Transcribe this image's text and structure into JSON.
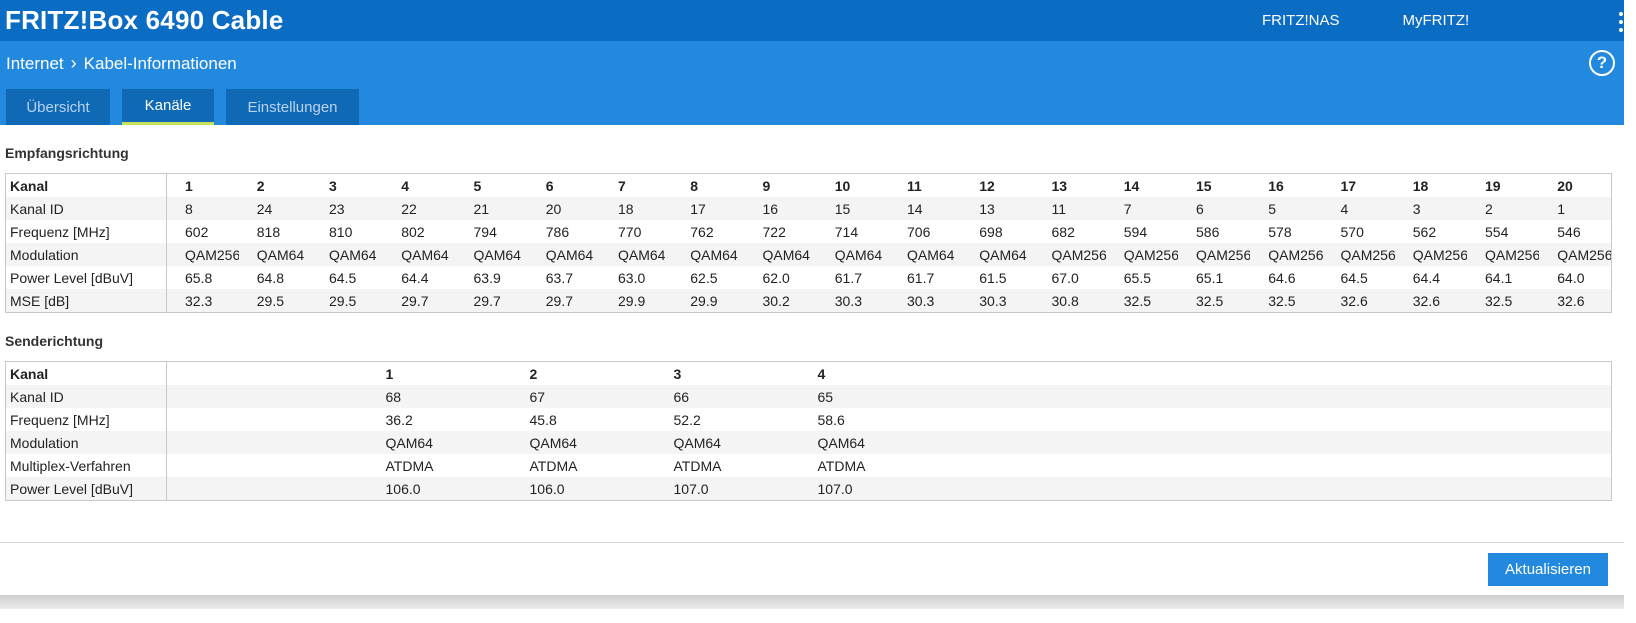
{
  "header": {
    "title": "FRITZ!Box 6490 Cable",
    "links": [
      "FRITZ!NAS",
      "MyFRITZ!"
    ]
  },
  "breadcrumb": [
    "Internet",
    "Kabel-Informationen"
  ],
  "tabs": [
    {
      "label": "Übersicht",
      "active": false
    },
    {
      "label": "Kanäle",
      "active": true
    },
    {
      "label": "Einstellungen",
      "active": false
    }
  ],
  "downstream": {
    "title": "Empfangsrichtung",
    "rows": [
      {
        "label": "Kanal",
        "values": [
          "1",
          "2",
          "3",
          "4",
          "5",
          "6",
          "7",
          "8",
          "9",
          "10",
          "11",
          "12",
          "13",
          "14",
          "15",
          "16",
          "17",
          "18",
          "19",
          "20"
        ]
      },
      {
        "label": "Kanal ID",
        "values": [
          "8",
          "24",
          "23",
          "22",
          "21",
          "20",
          "18",
          "17",
          "16",
          "15",
          "14",
          "13",
          "11",
          "7",
          "6",
          "5",
          "4",
          "3",
          "2",
          "1"
        ]
      },
      {
        "label": "Frequenz [MHz]",
        "values": [
          "602",
          "818",
          "810",
          "802",
          "794",
          "786",
          "770",
          "762",
          "722",
          "714",
          "706",
          "698",
          "682",
          "594",
          "586",
          "578",
          "570",
          "562",
          "554",
          "546"
        ]
      },
      {
        "label": "Modulation",
        "values": [
          "QAM256",
          "QAM64",
          "QAM64",
          "QAM64",
          "QAM64",
          "QAM64",
          "QAM64",
          "QAM64",
          "QAM64",
          "QAM64",
          "QAM64",
          "QAM64",
          "QAM256",
          "QAM256",
          "QAM256",
          "QAM256",
          "QAM256",
          "QAM256",
          "QAM256",
          "QAM256"
        ]
      },
      {
        "label": "Power Level [dBuV]",
        "values": [
          "65.8",
          "64.8",
          "64.5",
          "64.4",
          "63.9",
          "63.7",
          "63.0",
          "62.5",
          "62.0",
          "61.7",
          "61.7",
          "61.5",
          "67.0",
          "65.5",
          "65.1",
          "64.6",
          "64.5",
          "64.4",
          "64.1",
          "64.0"
        ]
      },
      {
        "label": "MSE [dB]",
        "values": [
          "32.3",
          "29.5",
          "29.5",
          "29.7",
          "29.7",
          "29.7",
          "29.9",
          "29.9",
          "30.2",
          "30.3",
          "30.3",
          "30.3",
          "30.8",
          "32.5",
          "32.5",
          "32.5",
          "32.6",
          "32.6",
          "32.5",
          "32.6"
        ]
      }
    ]
  },
  "upstream": {
    "title": "Senderichtung",
    "rows": [
      {
        "label": "Kanal",
        "values": [
          "1",
          "2",
          "3",
          "4"
        ]
      },
      {
        "label": "Kanal ID",
        "values": [
          "68",
          "67",
          "66",
          "65"
        ]
      },
      {
        "label": "Frequenz [MHz]",
        "values": [
          "36.2",
          "45.8",
          "52.2",
          "58.6"
        ]
      },
      {
        "label": "Modulation",
        "values": [
          "QAM64",
          "QAM64",
          "QAM64",
          "QAM64"
        ]
      },
      {
        "label": "Multiplex-Verfahren",
        "values": [
          "ATDMA",
          "ATDMA",
          "ATDMA",
          "ATDMA"
        ]
      },
      {
        "label": "Power Level [dBuV]",
        "values": [
          "106.0",
          "106.0",
          "107.0",
          "107.0"
        ]
      }
    ]
  },
  "refresh_button": "Aktualisieren"
}
